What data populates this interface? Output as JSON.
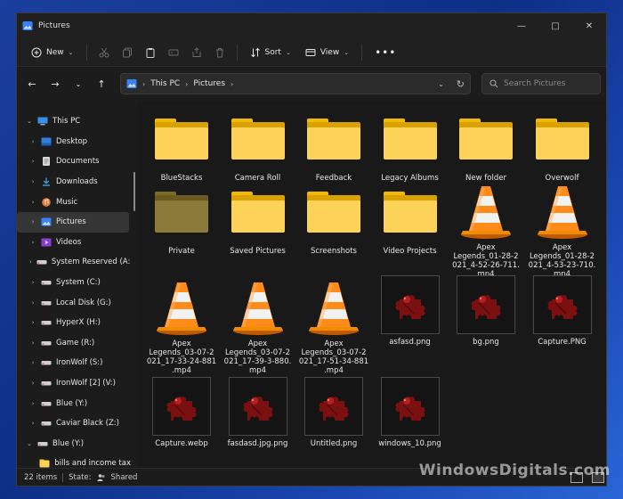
{
  "window": {
    "title": "Pictures"
  },
  "toolbar": {
    "new_label": "New",
    "sort_label": "Sort",
    "view_label": "View"
  },
  "address": {
    "crumbs": [
      "This PC",
      "Pictures"
    ],
    "search_placeholder": "Search Pictures"
  },
  "sidebar": {
    "items": [
      {
        "label": "This PC",
        "icon": "computer-icon",
        "expanded": true
      },
      {
        "label": "Desktop",
        "icon": "desktop-icon"
      },
      {
        "label": "Documents",
        "icon": "documents-icon"
      },
      {
        "label": "Downloads",
        "icon": "downloads-icon"
      },
      {
        "label": "Music",
        "icon": "music-icon"
      },
      {
        "label": "Pictures",
        "icon": "pictures-icon",
        "selected": true
      },
      {
        "label": "Videos",
        "icon": "videos-icon"
      },
      {
        "label": "System Reserved (A:)",
        "icon": "drive-icon"
      },
      {
        "label": "System (C:)",
        "icon": "drive-icon"
      },
      {
        "label": "Local Disk (G:)",
        "icon": "drive-icon"
      },
      {
        "label": "HyperX (H:)",
        "icon": "drive-icon"
      },
      {
        "label": "Game (R:)",
        "icon": "drive-icon"
      },
      {
        "label": "IronWolf (S:)",
        "icon": "drive-icon"
      },
      {
        "label": "IronWolf [2] (V:)",
        "icon": "drive-icon"
      },
      {
        "label": "Blue (Y:)",
        "icon": "drive-icon"
      },
      {
        "label": "Caviar Black (Z:)",
        "icon": "drive-icon"
      },
      {
        "label": "Blue (Y:)",
        "icon": "drive-icon",
        "expanded": true
      },
      {
        "label": "bills and income tax",
        "icon": "folder-icon"
      }
    ]
  },
  "files": [
    {
      "name": "BlueStacks",
      "kind": "folder"
    },
    {
      "name": "Camera Roll",
      "kind": "folder"
    },
    {
      "name": "Feedback",
      "kind": "folder"
    },
    {
      "name": "Legacy Albums",
      "kind": "folder"
    },
    {
      "name": "New folder",
      "kind": "folder"
    },
    {
      "name": "Overwolf",
      "kind": "folder"
    },
    {
      "name": "Private",
      "kind": "folder-hidden"
    },
    {
      "name": "Saved Pictures",
      "kind": "folder"
    },
    {
      "name": "Screenshots",
      "kind": "folder"
    },
    {
      "name": "Video Projects",
      "kind": "folder"
    },
    {
      "name": "Apex\nLegends_01-28-2\n021_4-52-26-711.\nmp4",
      "kind": "video"
    },
    {
      "name": "Apex\nLegends_01-28-2\n021_4-53-23-710.\nmp4",
      "kind": "video"
    },
    {
      "name": "Apex\nLegends_03-07-2\n021_17-33-24-881\n.mp4",
      "kind": "video"
    },
    {
      "name": "Apex\nLegends_03-07-2\n021_17-39-3-880.\nmp4",
      "kind": "video"
    },
    {
      "name": "Apex\nLegends_03-07-2\n021_17-51-34-881\n.mp4",
      "kind": "video"
    },
    {
      "name": "asfasd.png",
      "kind": "image"
    },
    {
      "name": "bg.png",
      "kind": "image"
    },
    {
      "name": "Capture.PNG",
      "kind": "image"
    },
    {
      "name": "Capture.webp",
      "kind": "image"
    },
    {
      "name": "fasdasd.jpg.png",
      "kind": "image"
    },
    {
      "name": "Untitled.png",
      "kind": "image"
    },
    {
      "name": "windows_10.png",
      "kind": "image"
    }
  ],
  "status": {
    "count": "22 items",
    "state_label": "State:",
    "state_value": "Shared"
  },
  "watermark": "WindowsDigitals.com",
  "colors": {
    "folder": "#fcd258",
    "selection": "#363636",
    "accent": "#1a4fc0"
  }
}
